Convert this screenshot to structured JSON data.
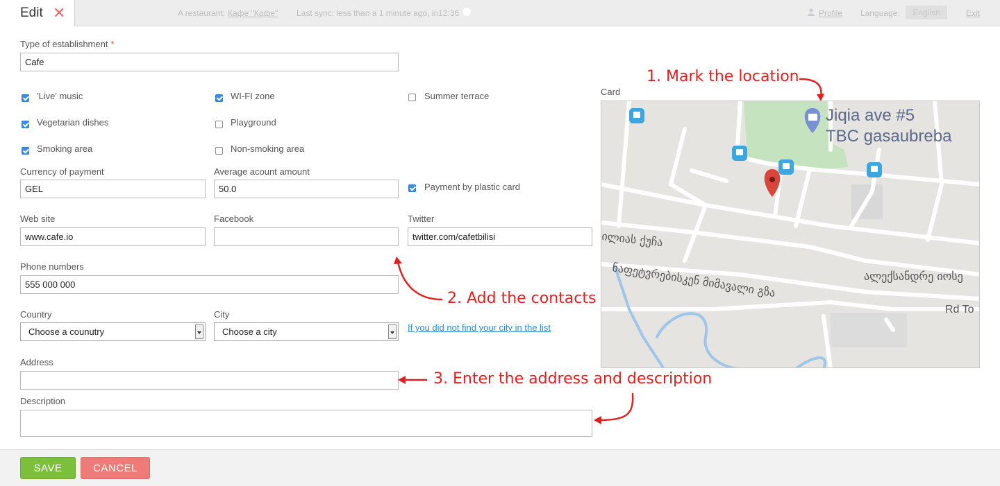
{
  "header": {
    "tab_title": "Edit",
    "close_glyph": "✕",
    "restaurant_prefix": "A restaurant:",
    "restaurant_name": "Кафе \"Кафе\"",
    "sync_text": "Last sync: less than a 1 minute ago, in12:36",
    "profile_label": "Profile",
    "language_label": "Language:",
    "language_value": "English",
    "exit_label": "Exit"
  },
  "form": {
    "type_label": "Type of establishment",
    "required_mark": "*",
    "type_value": "Cafe",
    "checkboxes": [
      {
        "label": "'Live' music",
        "checked": true
      },
      {
        "label": "WI-FI zone",
        "checked": true
      },
      {
        "label": "Summer terrace",
        "checked": false
      },
      {
        "label": "Vegetarian dishes",
        "checked": true
      },
      {
        "label": "Playground",
        "checked": false
      },
      {
        "label": "Smoking area",
        "checked": true
      },
      {
        "label": "Non-smoking area",
        "checked": false
      }
    ],
    "currency_label": "Currency of payment",
    "currency_value": "GEL",
    "avg_label": "Average acount amount",
    "avg_value": "50.0",
    "plastic_label": "Payment by plastic card",
    "plastic_checked": true,
    "website_label": "Web site",
    "website_value": "www.cafe.io",
    "facebook_label": "Facebook",
    "facebook_value": "",
    "twitter_label": "Twitter",
    "twitter_value": "twitter.com/cafetbilisi",
    "phone_label": "Phone numbers",
    "phone_value": "555 000 000",
    "country_label": "Country",
    "country_value": "Choose a counutry",
    "city_label": "City",
    "city_value": "Choose a city",
    "city_missing_link": "If you did not find your city in the list",
    "address_label": "Address",
    "address_value": "",
    "description_label": "Description",
    "description_value": ""
  },
  "map": {
    "card_label": "Card",
    "place_name_line1": "Jiqia ave #5",
    "place_name_line2": "TBC gasaubreba",
    "street_1": "ილიას ქუჩა",
    "street_2": "ნაფეტვრებისკენ მიმავალი გზა",
    "street_3": "ალექსანდრე იოსე",
    "street_4": "Rd To"
  },
  "annotations": {
    "step1": "1. Mark the location",
    "step2": "2. Add the contacts",
    "step3": "3. Enter the address and description",
    "color": "#e0201f"
  },
  "footer": {
    "save_label": "SAVE",
    "cancel_label": "CANCEL"
  }
}
